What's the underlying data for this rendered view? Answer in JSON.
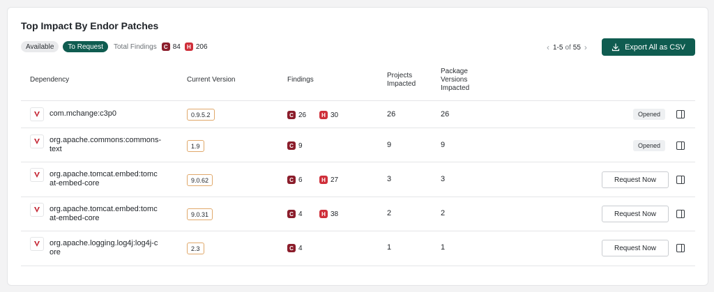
{
  "card": {
    "title": "Top Impact By Endor Patches",
    "filters": {
      "available_label": "Available",
      "request_label": "To Request",
      "total_label": "Total Findings",
      "critical_letter": "C",
      "critical_count": "84",
      "high_letter": "H",
      "high_count": "206"
    },
    "pager": {
      "range": "1-5",
      "of": "of",
      "total": "55"
    },
    "export_label": "Export All as CSV",
    "columns": {
      "dependency": "Dependency",
      "current_version": "Current Version",
      "findings": "Findings",
      "projects_1": "Projects",
      "projects_2": "Impacted",
      "pkg_1": "Package",
      "pkg_2": "Versions",
      "pkg_3": "Impacted"
    },
    "rows": [
      {
        "name_1": "com.mchange:c3p0",
        "name_2": "",
        "version": "0.9.5.2",
        "c_letter": "C",
        "c": "26",
        "h_letter": "H",
        "h": "30",
        "projects": "26",
        "pkg_versions": "26",
        "status": "Opened"
      },
      {
        "name_1": "org.apache.commons:commons-",
        "name_2": "text",
        "version": "1.9",
        "c_letter": "C",
        "c": "9",
        "h_letter": "",
        "h": "",
        "projects": "9",
        "pkg_versions": "9",
        "status": "Opened"
      },
      {
        "name_1": "org.apache.tomcat.embed:tomc",
        "name_2": "at-embed-core",
        "version": "9.0.62",
        "c_letter": "C",
        "c": "6",
        "h_letter": "H",
        "h": "27",
        "projects": "3",
        "pkg_versions": "3",
        "action": "Request Now"
      },
      {
        "name_1": "org.apache.tomcat.embed:tomc",
        "name_2": "at-embed-core",
        "version": "9.0.31",
        "c_letter": "C",
        "c": "4",
        "h_letter": "H",
        "h": "38",
        "projects": "2",
        "pkg_versions": "2",
        "action": "Request Now"
      },
      {
        "name_1": "org.apache.logging.log4j:log4j-c",
        "name_2": "ore",
        "version": "2.3",
        "c_letter": "C",
        "c": "4",
        "h_letter": "",
        "h": "",
        "projects": "1",
        "pkg_versions": "1",
        "action": "Request Now"
      }
    ]
  },
  "icons": {
    "maven": "maven-logo-icon",
    "download": "download-icon",
    "panel": "side-panel-icon",
    "chevron_left": "chevron-left-icon",
    "chevron_right": "chevron-right-icon"
  },
  "colors": {
    "accent": "#0f5c50",
    "critical": "#8b1d2b",
    "high": "#cf2f3a",
    "version_border": "#e0a86a"
  }
}
